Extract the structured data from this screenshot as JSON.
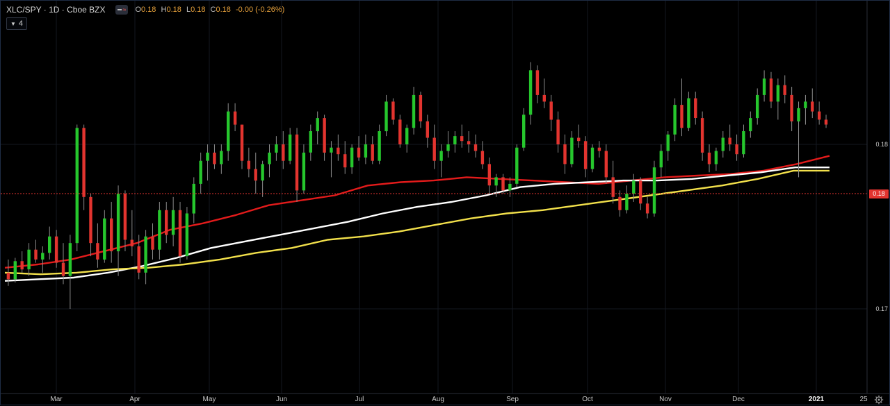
{
  "header": {
    "symbol": "XLC/SPY · 1D · Cboe BZX",
    "ohlc": {
      "open_label": "O",
      "open": "0.18",
      "high_label": "H",
      "high": "0.18",
      "low_label": "L",
      "low": "0.18",
      "close_label": "C",
      "close": "0.18",
      "change": "-0.00 (-0.26%)"
    },
    "studies_count": "4"
  },
  "colors": {
    "background": "#000000",
    "up": "#26c72d",
    "down": "#e3342f",
    "ma_fast": "#e31b1b",
    "ma_mid": "#ffffff",
    "ma_slow": "#f2e04b",
    "last_price_badge": "#e3342f"
  },
  "icons": [
    "eye-toggle-icon",
    "chevron-down-icon",
    "settings-gear-icon"
  ],
  "chart_data": {
    "type": "candlestick",
    "price_axis_labels": [
      "0.18",
      "0.17"
    ],
    "last_price_label": "0.18",
    "time_axis_labels": [
      "Mar",
      "Apr",
      "May",
      "Jun",
      "Jul",
      "Aug",
      "Sep",
      "Oct",
      "Nov",
      "Dec",
      "2021",
      "25"
    ],
    "series": [
      {
        "name": "",
        "kind": "moving-average",
        "color": "#e31b1b",
        "values": [
          0.1725,
          0.1727,
          0.173,
          0.1735,
          0.174,
          0.1748,
          0.1752,
          0.1757,
          0.1763,
          0.1766,
          0.1769,
          0.1775,
          0.1777,
          0.1778,
          0.178,
          0.1779,
          0.1778,
          0.1777,
          0.1776,
          0.1778,
          0.178,
          0.1781,
          0.1782,
          0.1784,
          0.1788,
          0.1793
        ]
      },
      {
        "name": "",
        "kind": "moving-average",
        "color": "#ffffff",
        "values": [
          0.1717,
          0.1718,
          0.1719,
          0.1722,
          0.1726,
          0.1731,
          0.1737,
          0.1741,
          0.1745,
          0.1749,
          0.1753,
          0.1758,
          0.1762,
          0.1765,
          0.1769,
          0.1774,
          0.1776,
          0.1777,
          0.1778,
          0.1778,
          0.1779,
          0.1781,
          0.1783,
          0.1786,
          0.1786
        ]
      },
      {
        "name": "",
        "kind": "moving-average",
        "color": "#f2e04b",
        "values": [
          0.1722,
          0.1721,
          0.1722,
          0.1724,
          0.1725,
          0.1727,
          0.173,
          0.1734,
          0.1737,
          0.1742,
          0.1744,
          0.1747,
          0.1751,
          0.1755,
          0.1758,
          0.176,
          0.1763,
          0.1766,
          0.1769,
          0.1772,
          0.1775,
          0.1779,
          0.1784,
          0.1784
        ]
      }
    ],
    "candles": [
      [
        0.1722,
        0.173,
        0.1714,
        0.1718
      ],
      [
        0.1718,
        0.1731,
        0.1716,
        0.1729
      ],
      [
        0.1729,
        0.1735,
        0.1722,
        0.1724
      ],
      [
        0.1724,
        0.174,
        0.172,
        0.1736
      ],
      [
        0.1736,
        0.1742,
        0.1728,
        0.173
      ],
      [
        0.173,
        0.1738,
        0.1722,
        0.1734
      ],
      [
        0.1734,
        0.175,
        0.173,
        0.1744
      ],
      [
        0.1744,
        0.1748,
        0.1725,
        0.1728
      ],
      [
        0.1728,
        0.174,
        0.1715,
        0.172
      ],
      [
        0.172,
        0.1745,
        0.17,
        0.174
      ],
      [
        0.174,
        0.1812,
        0.1735,
        0.181
      ],
      [
        0.181,
        0.1812,
        0.176,
        0.1768
      ],
      [
        0.1768,
        0.177,
        0.1732,
        0.174
      ],
      [
        0.174,
        0.1752,
        0.1725,
        0.173
      ],
      [
        0.173,
        0.176,
        0.1728,
        0.1755
      ],
      [
        0.1755,
        0.1765,
        0.1728,
        0.1735
      ],
      [
        0.1735,
        0.1775,
        0.172,
        0.177
      ],
      [
        0.177,
        0.1772,
        0.1735,
        0.1742
      ],
      [
        0.1742,
        0.176,
        0.1732,
        0.1738
      ],
      [
        0.1738,
        0.1745,
        0.1718,
        0.1722
      ],
      [
        0.1722,
        0.1748,
        0.1715,
        0.1744
      ],
      [
        0.1744,
        0.1752,
        0.173,
        0.1736
      ],
      [
        0.1736,
        0.1765,
        0.173,
        0.176
      ],
      [
        0.176,
        0.1765,
        0.174,
        0.1745
      ],
      [
        0.1745,
        0.1768,
        0.1738,
        0.176
      ],
      [
        0.176,
        0.1765,
        0.1728,
        0.1732
      ],
      [
        0.1732,
        0.1762,
        0.173,
        0.1758
      ],
      [
        0.1758,
        0.178,
        0.1752,
        0.1776
      ],
      [
        0.1776,
        0.1795,
        0.177,
        0.179
      ],
      [
        0.179,
        0.18,
        0.1778,
        0.1795
      ],
      [
        0.1795,
        0.18,
        0.1785,
        0.1788
      ],
      [
        0.1788,
        0.18,
        0.1782,
        0.1796
      ],
      [
        0.1796,
        0.1825,
        0.179,
        0.182
      ],
      [
        0.182,
        0.1825,
        0.1808,
        0.1812
      ],
      [
        0.1812,
        0.1812,
        0.1785,
        0.179
      ],
      [
        0.179,
        0.1798,
        0.178,
        0.1785
      ],
      [
        0.1785,
        0.1795,
        0.177,
        0.1778
      ],
      [
        0.1778,
        0.179,
        0.1768,
        0.1788
      ],
      [
        0.1788,
        0.18,
        0.178,
        0.1795
      ],
      [
        0.1795,
        0.1805,
        0.179,
        0.18
      ],
      [
        0.18,
        0.1808,
        0.1785,
        0.179
      ],
      [
        0.179,
        0.181,
        0.1788,
        0.1806
      ],
      [
        0.1806,
        0.181,
        0.1765,
        0.1772
      ],
      [
        0.1772,
        0.18,
        0.177,
        0.1795
      ],
      [
        0.1795,
        0.1812,
        0.179,
        0.1808
      ],
      [
        0.1808,
        0.182,
        0.18,
        0.1816
      ],
      [
        0.1816,
        0.1818,
        0.179,
        0.1795
      ],
      [
        0.1795,
        0.1802,
        0.178,
        0.1798
      ],
      [
        0.1798,
        0.1806,
        0.179,
        0.1794
      ],
      [
        0.1794,
        0.1802,
        0.1782,
        0.1786
      ],
      [
        0.1786,
        0.18,
        0.1782,
        0.1798
      ],
      [
        0.1798,
        0.1805,
        0.179,
        0.1792
      ],
      [
        0.1792,
        0.1806,
        0.1788,
        0.18
      ],
      [
        0.18,
        0.1805,
        0.1788,
        0.179
      ],
      [
        0.179,
        0.1812,
        0.1788,
        0.1808
      ],
      [
        0.1808,
        0.183,
        0.1805,
        0.1826
      ],
      [
        0.1826,
        0.1828,
        0.1812,
        0.1815
      ],
      [
        0.1815,
        0.1818,
        0.1798,
        0.18
      ],
      [
        0.18,
        0.1812,
        0.1795,
        0.181
      ],
      [
        0.181,
        0.1835,
        0.1806,
        0.183
      ],
      [
        0.183,
        0.1832,
        0.181,
        0.1814
      ],
      [
        0.1814,
        0.1818,
        0.1798,
        0.1804
      ],
      [
        0.1804,
        0.1812,
        0.1785,
        0.179
      ],
      [
        0.179,
        0.18,
        0.178,
        0.1796
      ],
      [
        0.1796,
        0.1808,
        0.1792,
        0.18
      ],
      [
        0.18,
        0.1808,
        0.1795,
        0.1805
      ],
      [
        0.1805,
        0.1812,
        0.1798,
        0.1802
      ],
      [
        0.1802,
        0.1808,
        0.1795,
        0.18
      ],
      [
        0.18,
        0.1806,
        0.1792,
        0.1796
      ],
      [
        0.1796,
        0.1802,
        0.1785,
        0.1788
      ],
      [
        0.1788,
        0.1792,
        0.177,
        0.1775
      ],
      [
        0.1775,
        0.1782,
        0.1768,
        0.178
      ],
      [
        0.178,
        0.1782,
        0.177,
        0.1772
      ],
      [
        0.1772,
        0.178,
        0.1768,
        0.1776
      ],
      [
        0.1776,
        0.18,
        0.1774,
        0.1798
      ],
      [
        0.1798,
        0.1822,
        0.1796,
        0.1818
      ],
      [
        0.1818,
        0.185,
        0.1812,
        0.1845
      ],
      [
        0.1845,
        0.1848,
        0.1825,
        0.183
      ],
      [
        0.183,
        0.184,
        0.1822,
        0.1826
      ],
      [
        0.1826,
        0.183,
        0.1808,
        0.1815
      ],
      [
        0.1815,
        0.182,
        0.1795,
        0.18
      ],
      [
        0.18,
        0.1806,
        0.1782,
        0.1788
      ],
      [
        0.1788,
        0.1808,
        0.1786,
        0.1804
      ],
      [
        0.1804,
        0.1812,
        0.1798,
        0.1802
      ],
      [
        0.1802,
        0.1805,
        0.178,
        0.1785
      ],
      [
        0.1785,
        0.18,
        0.1783,
        0.1798
      ],
      [
        0.1798,
        0.1802,
        0.1792,
        0.1796
      ],
      [
        0.1796,
        0.18,
        0.1776,
        0.178
      ],
      [
        0.178,
        0.179,
        0.1764,
        0.1768
      ],
      [
        0.1768,
        0.1772,
        0.1756,
        0.176
      ],
      [
        0.176,
        0.1775,
        0.1758,
        0.177
      ],
      [
        0.177,
        0.1782,
        0.1765,
        0.1778
      ],
      [
        0.1778,
        0.178,
        0.176,
        0.1764
      ],
      [
        0.1764,
        0.1768,
        0.1755,
        0.1758
      ],
      [
        0.1758,
        0.179,
        0.1756,
        0.1786
      ],
      [
        0.1786,
        0.18,
        0.178,
        0.1796
      ],
      [
        0.1796,
        0.1808,
        0.179,
        0.1806
      ],
      [
        0.1806,
        0.1828,
        0.1802,
        0.1824
      ],
      [
        0.1824,
        0.184,
        0.1805,
        0.181
      ],
      [
        0.181,
        0.1832,
        0.1808,
        0.1828
      ],
      [
        0.1828,
        0.1832,
        0.1812,
        0.1816
      ],
      [
        0.1816,
        0.182,
        0.179,
        0.1795
      ],
      [
        0.1795,
        0.18,
        0.1783,
        0.1788
      ],
      [
        0.1788,
        0.1798,
        0.1784,
        0.1796
      ],
      [
        0.1796,
        0.1808,
        0.1792,
        0.1804
      ],
      [
        0.1804,
        0.1812,
        0.1796,
        0.18
      ],
      [
        0.18,
        0.1806,
        0.179,
        0.1794
      ],
      [
        0.1794,
        0.1812,
        0.1792,
        0.1808
      ],
      [
        0.1808,
        0.182,
        0.1804,
        0.1816
      ],
      [
        0.1816,
        0.1834,
        0.1812,
        0.183
      ],
      [
        0.183,
        0.1845,
        0.1826,
        0.184
      ],
      [
        0.184,
        0.1844,
        0.1822,
        0.1826
      ],
      [
        0.1826,
        0.184,
        0.1815,
        0.1836
      ],
      [
        0.1836,
        0.1842,
        0.1825,
        0.183
      ],
      [
        0.183,
        0.1835,
        0.1808,
        0.1814
      ],
      [
        0.1814,
        0.1826,
        0.178,
        0.1822
      ],
      [
        0.1822,
        0.183,
        0.1812,
        0.1826
      ],
      [
        0.1826,
        0.1834,
        0.1816,
        0.182
      ],
      [
        0.182,
        0.1826,
        0.1812,
        0.1815
      ],
      [
        0.1815,
        0.1818,
        0.181,
        0.1812
      ]
    ]
  }
}
